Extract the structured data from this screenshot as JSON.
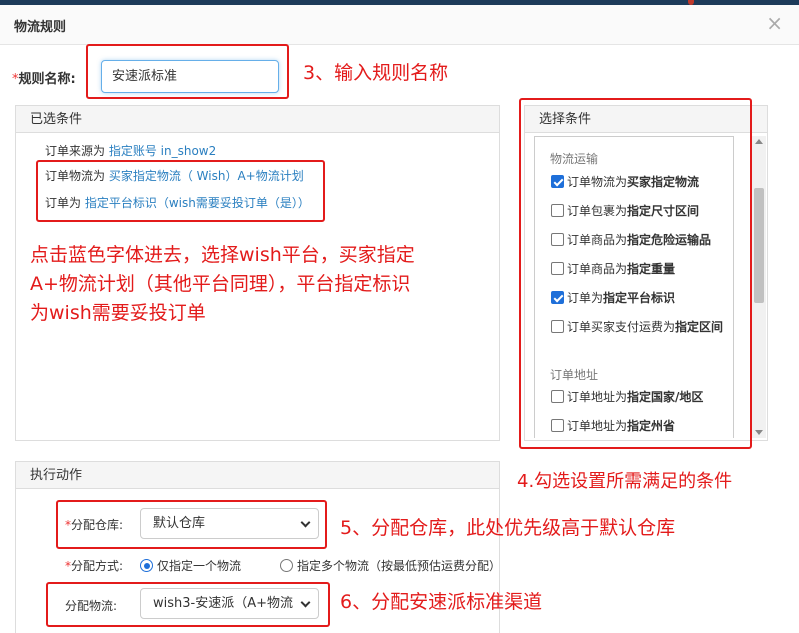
{
  "modal": {
    "title": "物流规则",
    "close": "×"
  },
  "rule_name": {
    "label": "规则名称:",
    "required_mark": "*",
    "value": "安速派标准"
  },
  "selected_conditions": {
    "header": "已选条件",
    "lines": [
      {
        "prefix": "订单来源为",
        "link": "指定账号 in_show2"
      },
      {
        "prefix": "订单物流为",
        "link": "买家指定物流（ Wish）A+物流计划"
      },
      {
        "prefix": "订单为",
        "link": "指定平台标识（wish需要妥投订单（是））"
      }
    ]
  },
  "select_conditions": {
    "header": "选择条件",
    "groups": [
      {
        "title": "物流运输",
        "items": [
          {
            "pre": "订单物流为",
            "bold": "买家指定物流",
            "checked": true
          },
          {
            "pre": "订单包裹为",
            "bold": "指定尺寸区间",
            "checked": false
          },
          {
            "pre": "订单商品为",
            "bold": "指定危险运输品",
            "checked": false
          },
          {
            "pre": "订单商品为",
            "bold": "指定重量",
            "checked": false
          },
          {
            "pre": "订单为",
            "bold": "指定平台标识",
            "checked": true
          },
          {
            "pre": "订单买家支付运费为",
            "bold": "指定区间",
            "checked": false
          }
        ]
      },
      {
        "title": "订单地址",
        "items": [
          {
            "pre": "订单地址为",
            "bold": "指定国家/地区",
            "checked": false
          },
          {
            "pre": "订单地址为",
            "bold": "指定州省",
            "checked": false
          }
        ]
      }
    ]
  },
  "actions": {
    "header": "执行动作",
    "warehouse": {
      "required_mark": "*",
      "label": "分配仓库:",
      "value": "默认仓库"
    },
    "method": {
      "required_mark": "*",
      "label": "分配方式:",
      "options": [
        {
          "label": "仅指定一个物流",
          "selected": true
        },
        {
          "label": "指定多个物流（按最低预估运费分配）",
          "selected": false
        }
      ]
    },
    "logistics": {
      "label": "分配物流:",
      "value": "wish3-安速派（A+物流"
    }
  },
  "annotations": {
    "step3": "3、输入规则名称",
    "instructions": [
      "点击蓝色字体进去，选择wish平台，买家指定",
      "A+物流计划（其他平台同理），平台指定标识",
      "为wish需要妥投订单"
    ],
    "step4": "4.勾选设置所需满足的条件",
    "step5": "5、分配仓库，此处优先级高于默认仓库",
    "step6": "6、分配安速派标准渠道"
  },
  "colors": {
    "annotation_red": "#e31b1b",
    "link_blue": "#2a7fc0",
    "checkbox_blue": "#1e6fd9"
  }
}
